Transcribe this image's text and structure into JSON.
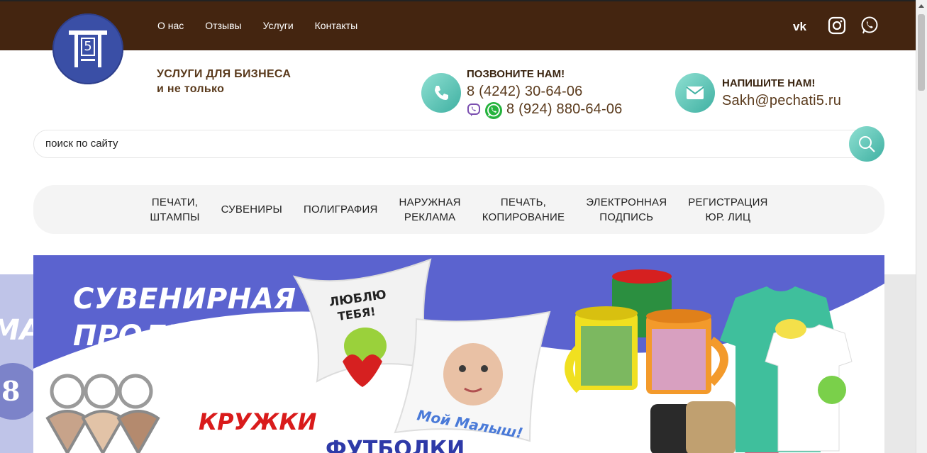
{
  "header": {
    "nav": [
      "О нас",
      "Отзывы",
      "Услуги",
      "Контакты"
    ],
    "social_icons": [
      "vk-icon",
      "instagram-icon",
      "whatsapp-icon"
    ],
    "tagline_line1": "УСЛУГИ ДЛЯ БИЗНЕСА",
    "tagline_line2": "и не только"
  },
  "logo": {
    "digit": "5"
  },
  "call": {
    "heading": "ПОЗВОНИТЕ НАМ!",
    "phone1": "8 (4242) 30-64-06",
    "phone2": "8 (924) 880-64-06"
  },
  "write": {
    "heading": "НАПИШИТЕ НАМ!",
    "email": "Sakh@pechati5.ru"
  },
  "search": {
    "placeholder": "поиск по сайту"
  },
  "menu": [
    "ПЕЧАТИ,\nШТАМПЫ",
    "СУВЕНИРЫ",
    "ПОЛИГРАФИЯ",
    "НАРУЖНАЯ\nРЕКЛАМА",
    "ПЕЧАТЬ,\nКОПИРОВАНИЕ",
    "ЭЛЕКТРОННАЯ\nПОДПИСЬ",
    "РЕГИСТРАЦИЯ\nЮР. ЛИЦ"
  ],
  "banner": {
    "title_line1": "СУВЕНИРНАЯ",
    "title_line2": "ПРОДУКЦИЯ",
    "mugs": "КРУЖКИ",
    "tshirts": "ФУТБОЛКИ",
    "pillow_text": "Мой Малыш!",
    "pillow_text2": "ЛЮБЛЮ ТЕБЯ!"
  },
  "colors": {
    "topbar": "#442510",
    "accent_teal": "#3fb0a2",
    "logo_blue": "#3a4fa6",
    "banner_blue": "#5b63cf"
  }
}
